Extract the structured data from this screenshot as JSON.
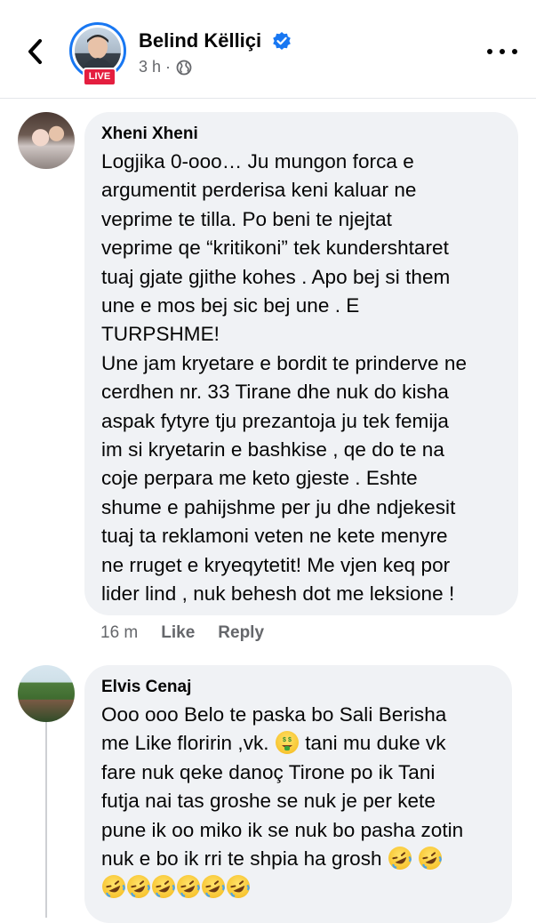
{
  "header": {
    "author_name": "Belind Këlliçi",
    "live_label": "LIVE",
    "time": "3 h ·"
  },
  "comments": [
    {
      "name": "Xheni Xheni",
      "text": "Logjika 0-ooo…  Ju mungon forca e\nargumentit  perderisa keni kaluar ne\nveprime te tilla.  Po beni te njejtat\nveprime qe “kritikoni” tek kundershtaret\ntuaj gjate gjithe kohes . Apo bej si them\nune e mos bej sic bej une .  E\nTURPSHME!\nUne jam kryetare e bordit te prinderve ne\ncerdhen nr. 33 Tirane dhe nuk do kisha\naspak fytyre tju prezantoja ju tek femija\nim si kryetarin e bashkise , qe do te na\ncoje perpara me keto gjeste .  Eshte\nshume e pahijshme per ju dhe ndjekesit\ntuaj ta reklamoni veten ne kete menyre\nne rruget e kryeqytetit!  Me vjen keq por\nlider lind , nuk behesh dot me leksione !",
      "time": "16 m",
      "like_label": "Like",
      "reply_label": "Reply"
    },
    {
      "name": "Elvis Cenaj",
      "text_line1": "Ooo ooo Belo te paska bo Sali Berisha",
      "text_line2a": "me Like floririn ,vk. ",
      "text_line2b": "  tani mu duke vk",
      "text_rest": "fare nuk qeke danoç Tirone po ik Tani\nfutja nai tas groshe se nuk je per kete\npune ik oo miko ik se nuk bo pasha zotin\nnuk e bo ik rri te shpia ha grosh "
    }
  ],
  "icons": {
    "back": "chevron-left-icon",
    "verified": "verified-badge-icon",
    "privacy": "globe-icon",
    "more": "more-dots-icon",
    "emoji_money": "money-mouth-face-emoji",
    "emoji_laugh": "rolling-on-floor-laughing-emoji"
  },
  "colors": {
    "accent": "#1877f2",
    "live": "#e41e3f",
    "bubble": "#f0f2f5",
    "secondary_text": "#65676b"
  }
}
